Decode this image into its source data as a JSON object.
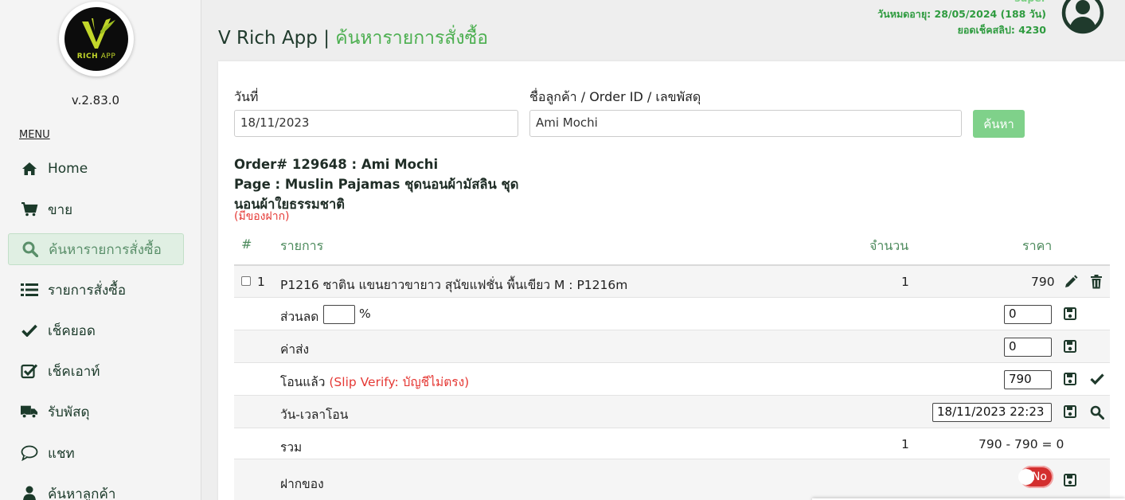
{
  "sidebar": {
    "logo_text": "RICH",
    "logo_text_app": "APP",
    "version": "v.2.83.0",
    "menu_title": "MENU",
    "items": [
      {
        "label": "Home",
        "icon": "home-icon"
      },
      {
        "label": "ขาย",
        "icon": "cart-icon"
      },
      {
        "label": "ค้นหารายการสั่งซื้อ",
        "icon": "search-icon",
        "active": true
      },
      {
        "label": "รายการสั่งซื้อ",
        "icon": "list-icon"
      },
      {
        "label": "เช็คยอด",
        "icon": "check-icon"
      },
      {
        "label": "เช็คเอาท์",
        "icon": "checkbox-icon"
      },
      {
        "label": "รับพัสดุ",
        "icon": "truck-icon"
      },
      {
        "label": "แชท",
        "icon": "chat-icon"
      },
      {
        "label": "ค้นหาลูกค้า",
        "icon": "user-icon"
      }
    ]
  },
  "header": {
    "app_name": "V Rich App | ",
    "page_name": "ค้นหารายการสั่งซื้อ",
    "username": "super",
    "expiry": "วันหมดอายุ: 28/05/2024 (188 วัน)",
    "slip_balance": "ยอดเช็คสลิป: 4230"
  },
  "search": {
    "date_label": "วันที่",
    "date_value": "18/11/2023",
    "query_label": "ชื่อลูกค้า / Order ID / เลขพัสดุ",
    "query_value": "Ami Mochi",
    "button_label": "ค้นหา"
  },
  "order": {
    "title": "Order# 129648 : Ami Mochi",
    "page": "Page : Muslin Pajamas ชุดนอนผ้ามัสลิน ชุดนอนผ้าใยธรรมชาติ",
    "note": "(มีของฝาก)"
  },
  "table": {
    "headers": {
      "num": "#",
      "item": "รายการ",
      "qty": "จำนวน",
      "price": "ราคา"
    },
    "item_row": {
      "num": "1",
      "name": "P1216 ซาติน แขนยาวขายาว สุนัขแฟชั่น พื้นเขียว M : P1216m",
      "qty": "1",
      "price": "790"
    },
    "discount": {
      "label": "ส่วนลด",
      "percent_value": "",
      "percent_sign": "%",
      "amount": "0"
    },
    "shipping": {
      "label": "ค่าส่ง",
      "amount": "0"
    },
    "transfer": {
      "label": "โอนแล้ว",
      "slip_note": "(Slip Verify: บัญชีไม่ตรง)",
      "amount": "790"
    },
    "transfer_time": {
      "label": "วัน-เวลาโอน",
      "value": "18/11/2023 22:23"
    },
    "total": {
      "label": "รวม",
      "qty": "1",
      "calc": "790 - 790 = 0"
    },
    "deposit": {
      "label": "ฝากของ",
      "toggle": "No"
    }
  },
  "colors": {
    "brand": "#4caf50",
    "accent_light": "#7fd18a",
    "warning": "#e53935"
  }
}
